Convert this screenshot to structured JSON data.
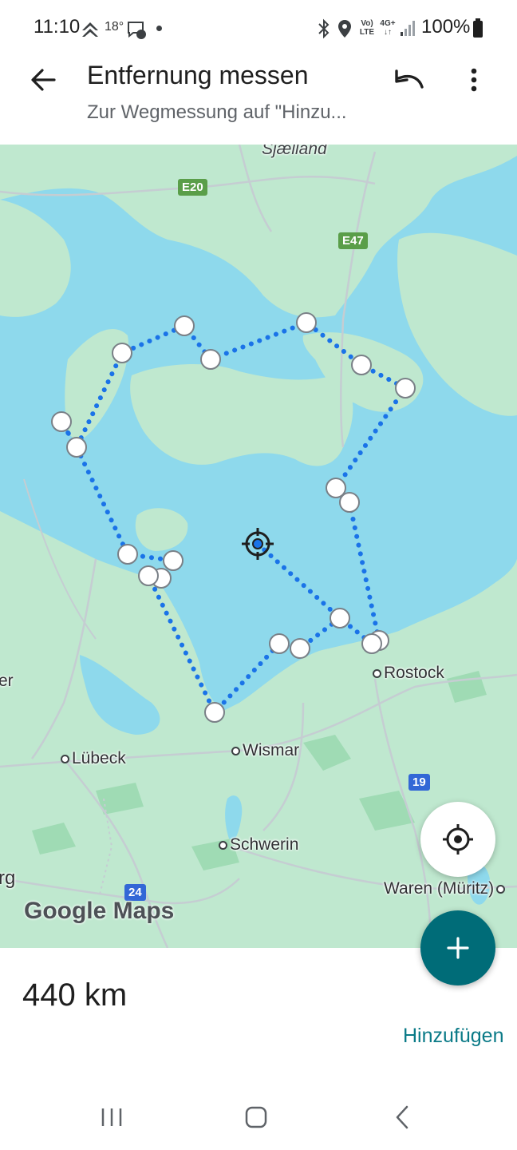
{
  "status_bar": {
    "time": "11:10",
    "temperature": "18°",
    "battery_percent": "100%",
    "icons": [
      "navigation-arrow-icon",
      "messages-facebook-icon",
      "dot-icon",
      "bluetooth-icon",
      "location-icon",
      "volte-icon",
      "4g-icon",
      "signal-icon",
      "battery-icon"
    ],
    "volte_label": "Vo)",
    "lte_label": "LTE",
    "network_label": "4G+"
  },
  "header": {
    "title": "Entfernung messen",
    "subtitle": "Zur Wegmessung auf \"Hinzu...",
    "back_icon": "arrow-left-icon",
    "undo_icon": "undo-icon",
    "more_icon": "more-vertical-icon"
  },
  "map": {
    "labels": {
      "sjaelland": "Sjælland",
      "rostock": "Rostock",
      "wismar": "Wismar",
      "luebeck": "Lübeck",
      "schwerin": "Schwerin",
      "waren": "Waren (Müritz)",
      "edge_left_1": "er",
      "edge_left_2": "rg"
    },
    "road_shields": {
      "e20": "E20",
      "e47": "E47",
      "n19": "19",
      "n24": "24"
    },
    "watermark": "Google Maps",
    "colors": {
      "water": "#8ed9ec",
      "land": "#bfe8cf",
      "route": "#1a73e8"
    }
  },
  "fabs": {
    "my_location_icon": "crosshair-location-icon",
    "add_icon": "plus-icon"
  },
  "bottom_sheet": {
    "distance": "440 km",
    "add_label": "Hinzufügen"
  },
  "nav_bar": {
    "icons": [
      "recent-apps-icon",
      "home-icon",
      "back-icon"
    ]
  }
}
